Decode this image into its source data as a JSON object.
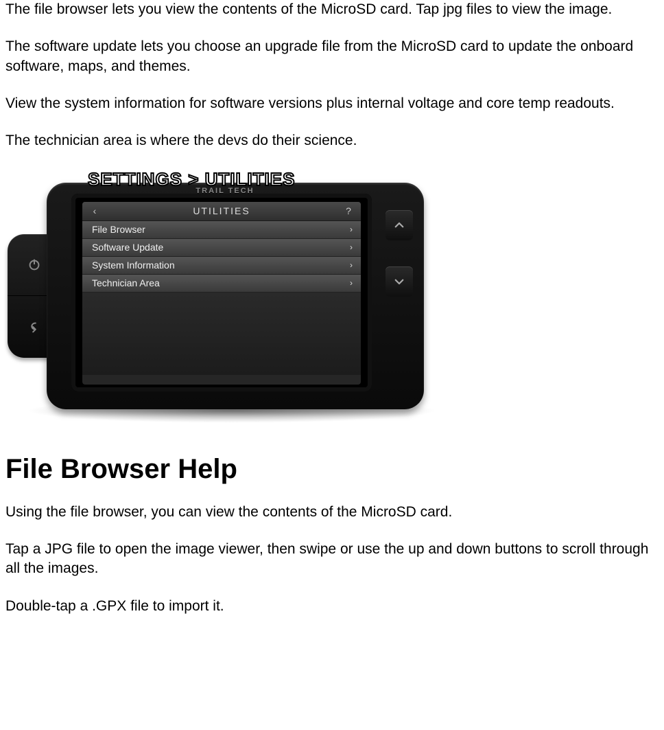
{
  "paragraphs": {
    "p1": "The file browser lets you view the contents of the MicroSD card. Tap jpg files to view the image.",
    "p2": "The software update lets you choose an upgrade file from the MicroSD card to update the onboard software, maps, and themes.",
    "p3": "View the system information for software versions plus internal voltage and core temp readouts.",
    "p4": "The technician area is where the devs do their science."
  },
  "figure": {
    "caption": "SETTINGS > UTILITIES",
    "brand": "TRAIL TECH",
    "header": {
      "back": "‹",
      "title": "UTILITIES",
      "help": "?"
    },
    "menu": [
      {
        "label": "File Browser"
      },
      {
        "label": "Software Update"
      },
      {
        "label": "System Information"
      },
      {
        "label": "Technician Area"
      }
    ],
    "side_up": "ˆ",
    "side_down": "ˇ"
  },
  "section": {
    "heading": "File Browser Help",
    "p5": "Using the file browser, you can view the contents of the MicroSD card.",
    "p6": "Tap a JPG file to open the image viewer, then swipe or use the up and down buttons to scroll through all the images.",
    "p7": "Double-tap a .GPX file to import it."
  }
}
